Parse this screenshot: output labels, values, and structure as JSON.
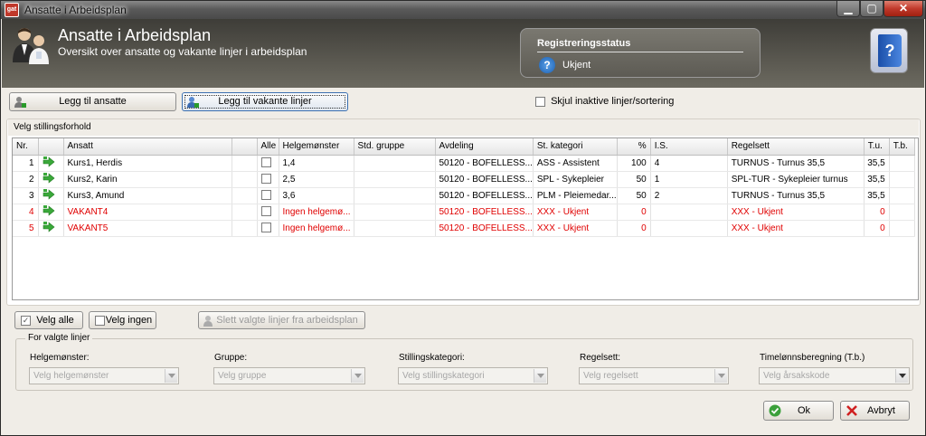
{
  "window": {
    "title": "Ansatte i Arbeidsplan"
  },
  "header": {
    "title": "Ansatte i Arbeidsplan",
    "subtitle": "Oversikt over ansatte og vakante linjer i arbeidsplan",
    "status_title": "Registreringsstatus",
    "status_value": "Ukjent"
  },
  "toolbar": {
    "add_employees": "Legg til ansatte",
    "add_vacant": "Legg til vakante linjer",
    "hide_inactive": "Skjul inaktive linjer/sortering"
  },
  "group_select": {
    "label": "Velg stillingsforhold"
  },
  "grid": {
    "columns": [
      "Nr.",
      "",
      "Ansatt",
      "",
      "Alle",
      "Helgemønster",
      "Std. gruppe",
      "Avdeling",
      "St. kategori",
      "%",
      "I.S.",
      "Regelsett",
      "T.u.",
      "T.b."
    ],
    "rows": [
      {
        "nr": "1",
        "ansatt": "Kurs1, Herdis",
        "helg": "1,4",
        "std": "",
        "avd": "50120 - BOFELLESS...",
        "kat": "ASS - Assistent",
        "pct": "100",
        "is": "4",
        "regel": "TURNUS - Turnus 35,5",
        "tu": "35,5",
        "tb": "",
        "vacant": false
      },
      {
        "nr": "2",
        "ansatt": "Kurs2, Karin",
        "helg": "2,5",
        "std": "",
        "avd": "50120 - BOFELLESS...",
        "kat": "SPL - Sykepleier",
        "pct": "50",
        "is": "1",
        "regel": "SPL-TUR - Sykepleier turnus",
        "tu": "35,5",
        "tb": "",
        "vacant": false
      },
      {
        "nr": "3",
        "ansatt": "Kurs3, Amund",
        "helg": "3,6",
        "std": "",
        "avd": "50120 - BOFELLESS...",
        "kat": "PLM - Pleiemedar...",
        "pct": "50",
        "is": "2",
        "regel": "TURNUS - Turnus 35,5",
        "tu": "35,5",
        "tb": "",
        "vacant": false
      },
      {
        "nr": "4",
        "ansatt": "VAKANT4",
        "helg": "Ingen helgemø...",
        "std": "",
        "avd": "50120 - BOFELLESS...",
        "kat": "XXX - Ukjent",
        "pct": "0",
        "is": "",
        "regel": "XXX - Ukjent",
        "tu": "0",
        "tb": "",
        "vacant": true
      },
      {
        "nr": "5",
        "ansatt": "VAKANT5",
        "helg": "Ingen helgemø...",
        "std": "",
        "avd": "50120 - BOFELLESS...",
        "kat": "XXX - Ukjent",
        "pct": "0",
        "is": "",
        "regel": "XXX - Ukjent",
        "tu": "0",
        "tb": "",
        "vacant": true
      }
    ]
  },
  "selection": {
    "select_all": "Velg alle",
    "select_none": "Velg ingen",
    "delete_selected": "Slett valgte linjer fra arbeidsplan"
  },
  "for_selected": {
    "label": "For valgte linjer",
    "fields": [
      {
        "label": "Helgemønster:",
        "placeholder": "Velg helgemønster"
      },
      {
        "label": "Gruppe:",
        "placeholder": "Velg gruppe"
      },
      {
        "label": "Stillingskategori:",
        "placeholder": "Velg stillingskategori"
      },
      {
        "label": "Regelsett:",
        "placeholder": "Velg regelsett"
      },
      {
        "label": "Timelønnsberegning (T.b.)",
        "placeholder": "Velg årsakskode"
      }
    ]
  },
  "actions": {
    "ok": "Ok",
    "cancel": "Avbryt"
  },
  "colors": {
    "vacant_text": "#e00000",
    "header_bg": "#4e4c46"
  }
}
